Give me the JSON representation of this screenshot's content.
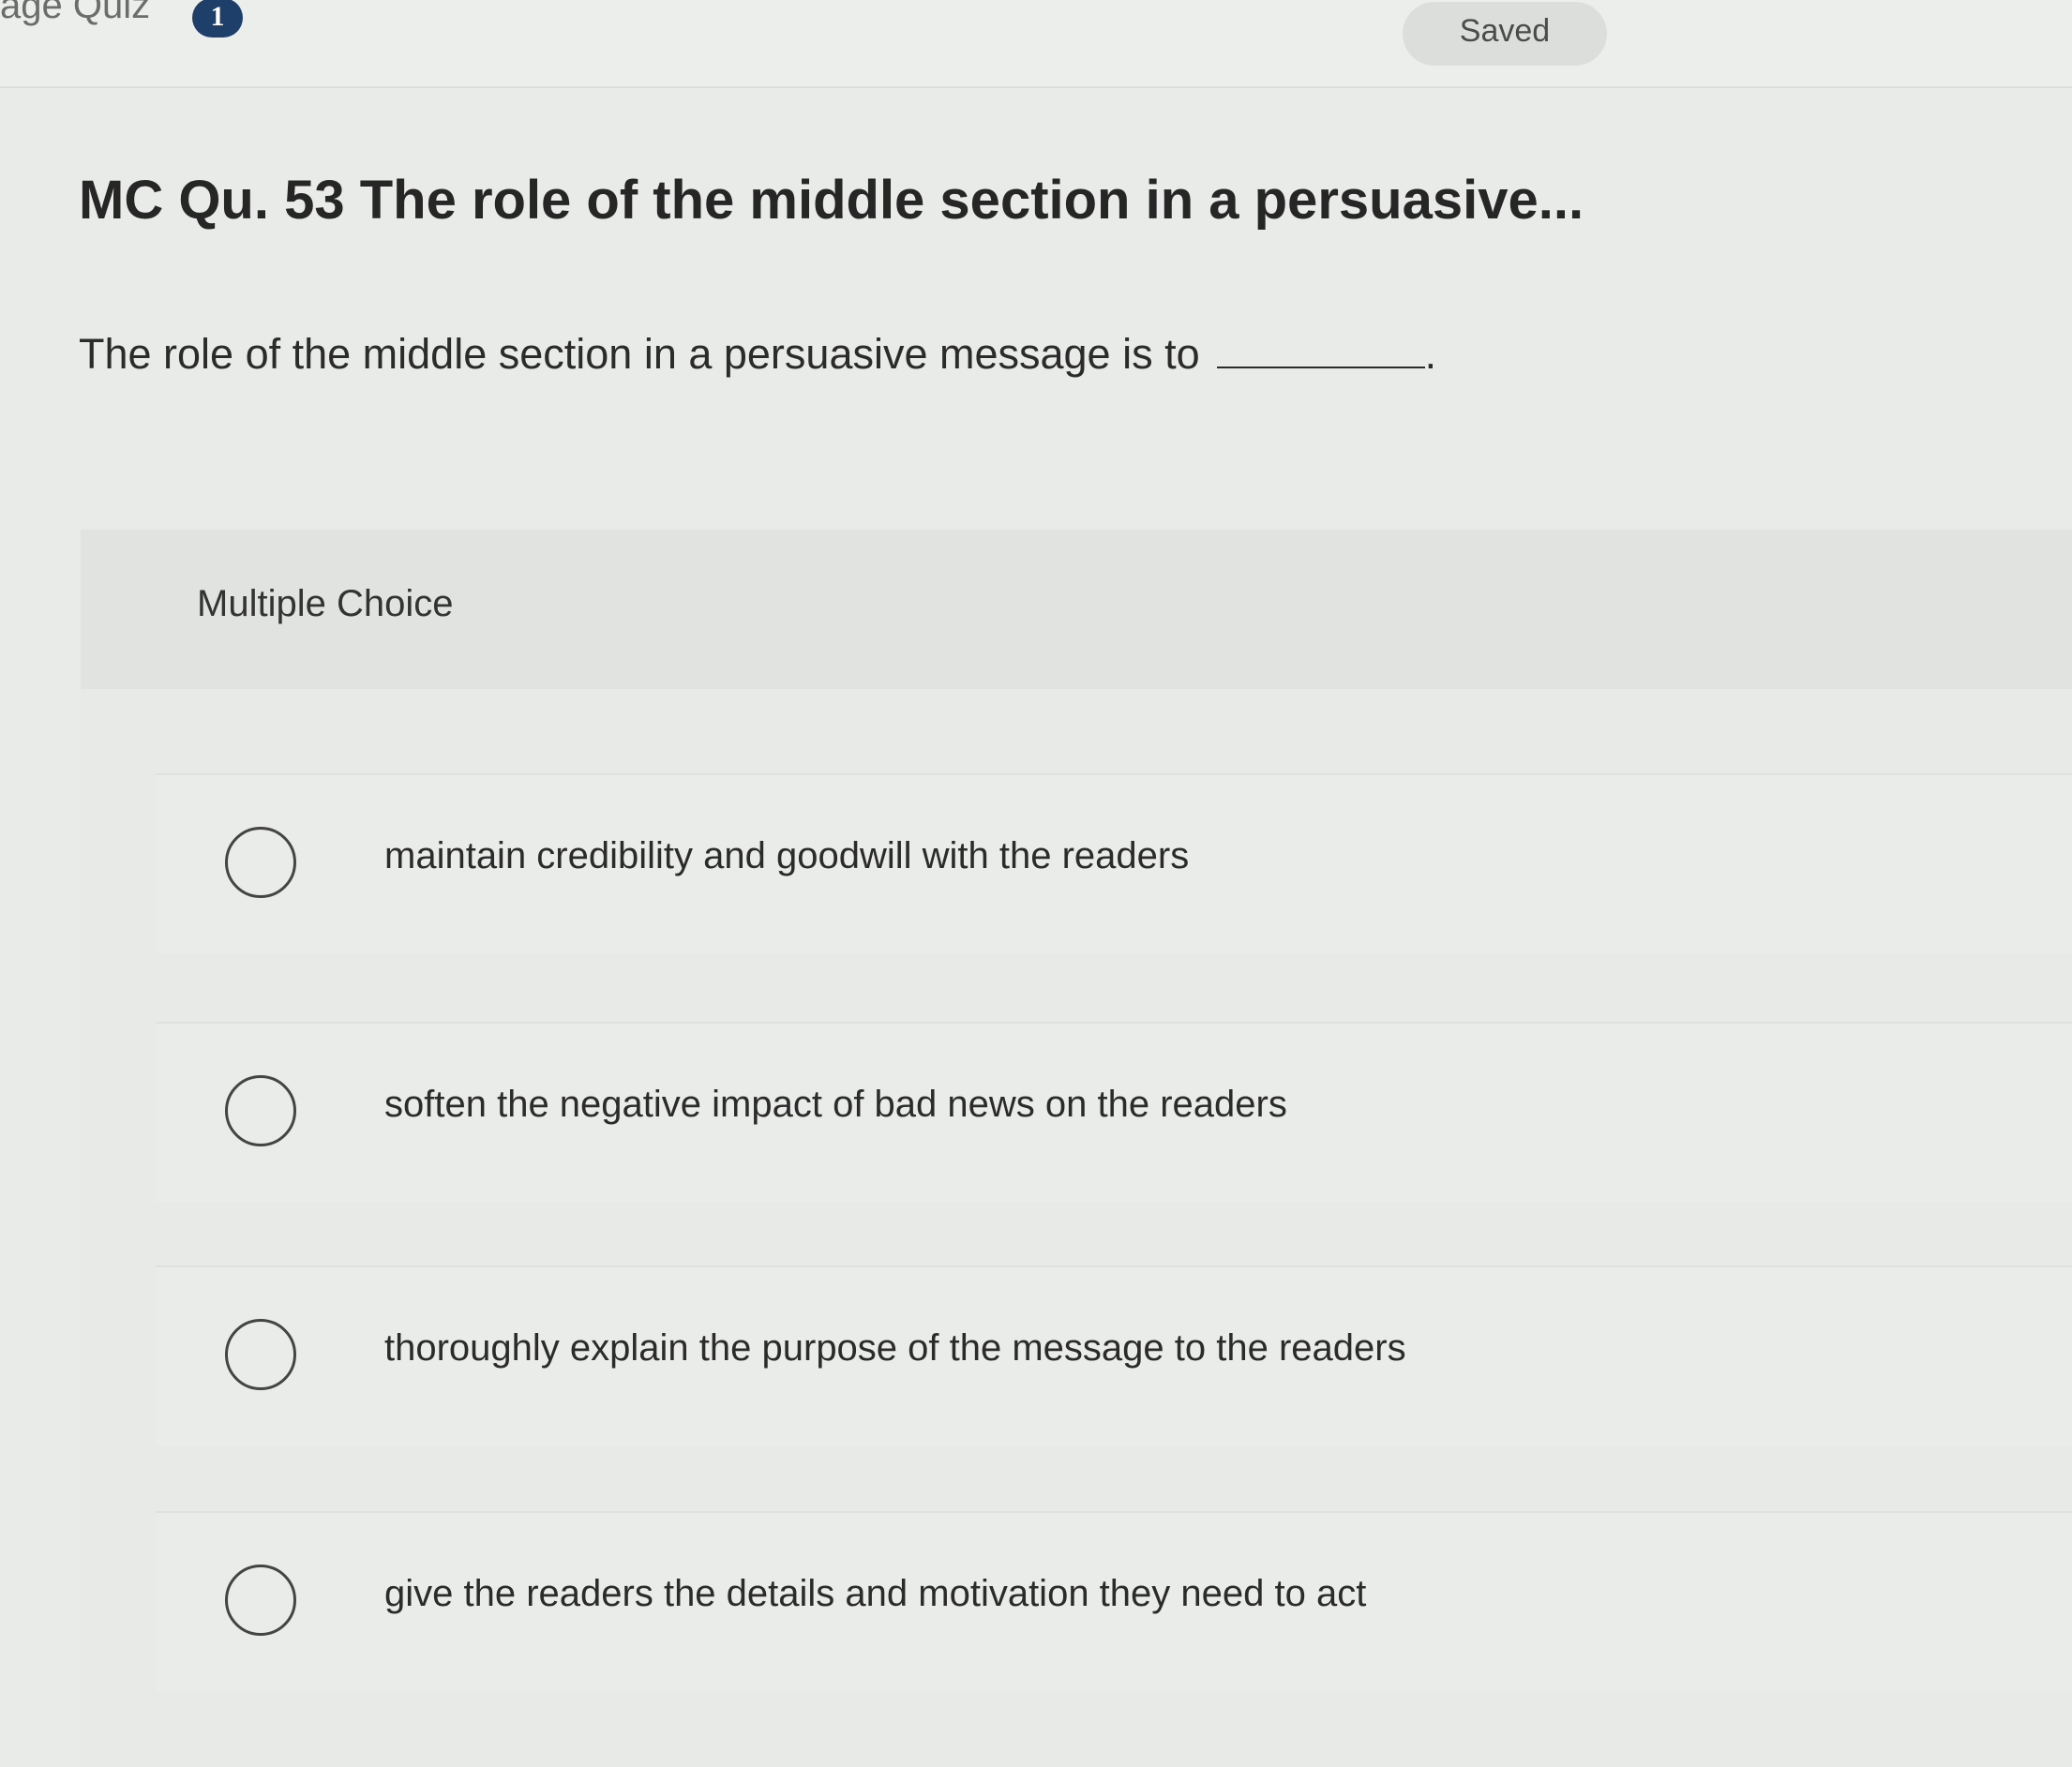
{
  "header": {
    "quiz_title": "age Quiz",
    "badge_count": "1",
    "save_status": "Saved"
  },
  "question": {
    "title": "MC Qu. 53 The role of the middle section in a persuasive...",
    "prompt": "The role of the middle section in a persuasive message is to",
    "prompt_end": ".",
    "type_label": "Multiple Choice"
  },
  "choices": [
    {
      "text": "maintain credibility and goodwill with the readers"
    },
    {
      "text": "soften the negative impact of bad news on the readers"
    },
    {
      "text": "thoroughly explain the purpose of the message to the readers"
    },
    {
      "text": "give the readers the details and motivation they need to act"
    }
  ]
}
